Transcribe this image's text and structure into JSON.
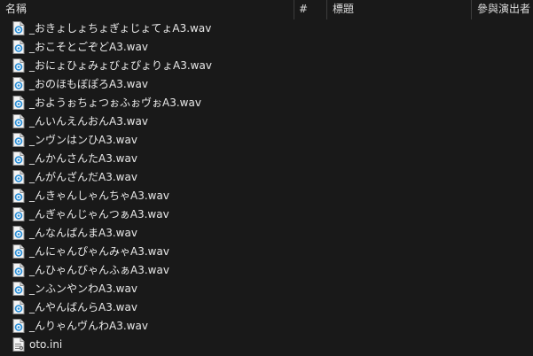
{
  "columns": {
    "name": "名稱",
    "number": "#",
    "title": "標題",
    "artist": "參與演出者"
  },
  "sort_indicator": "^",
  "files": [
    {
      "name": "_おきょしょちょぎょじょてょA3.wav",
      "icon": "wav-audio-icon"
    },
    {
      "name": "_おこそとごぞどA3.wav",
      "icon": "wav-audio-icon"
    },
    {
      "name": "_おにょひょみょびょぴょりょA3.wav",
      "icon": "wav-audio-icon"
    },
    {
      "name": "_おのほもぼぽろA3.wav",
      "icon": "wav-audio-icon"
    },
    {
      "name": "_おようぉちょつぉふぉヴぉA3.wav",
      "icon": "wav-audio-icon"
    },
    {
      "name": "_んいんえんおんA3.wav",
      "icon": "wav-audio-icon"
    },
    {
      "name": "_ンヴンはンひA3.wav",
      "icon": "wav-audio-icon"
    },
    {
      "name": "_んかんさんたA3.wav",
      "icon": "wav-audio-icon"
    },
    {
      "name": "_んがんざんだA3.wav",
      "icon": "wav-audio-icon"
    },
    {
      "name": "_んきゃんしゃんちゃA3.wav",
      "icon": "wav-audio-icon"
    },
    {
      "name": "_んぎゃんじゃんつぁA3.wav",
      "icon": "wav-audio-icon"
    },
    {
      "name": "_んなんぱんまA3.wav",
      "icon": "wav-audio-icon"
    },
    {
      "name": "_んにゃんぴゃんみゃA3.wav",
      "icon": "wav-audio-icon"
    },
    {
      "name": "_んひゃんびゃんふぁA3.wav",
      "icon": "wav-audio-icon"
    },
    {
      "name": "_ンふンやンわA3.wav",
      "icon": "wav-audio-icon"
    },
    {
      "name": "_んやんばんらA3.wav",
      "icon": "wav-audio-icon"
    },
    {
      "name": "_んりゃんヴんわA3.wav",
      "icon": "wav-audio-icon"
    },
    {
      "name": "oto.ini",
      "icon": "ini-settings-file-icon"
    }
  ]
}
